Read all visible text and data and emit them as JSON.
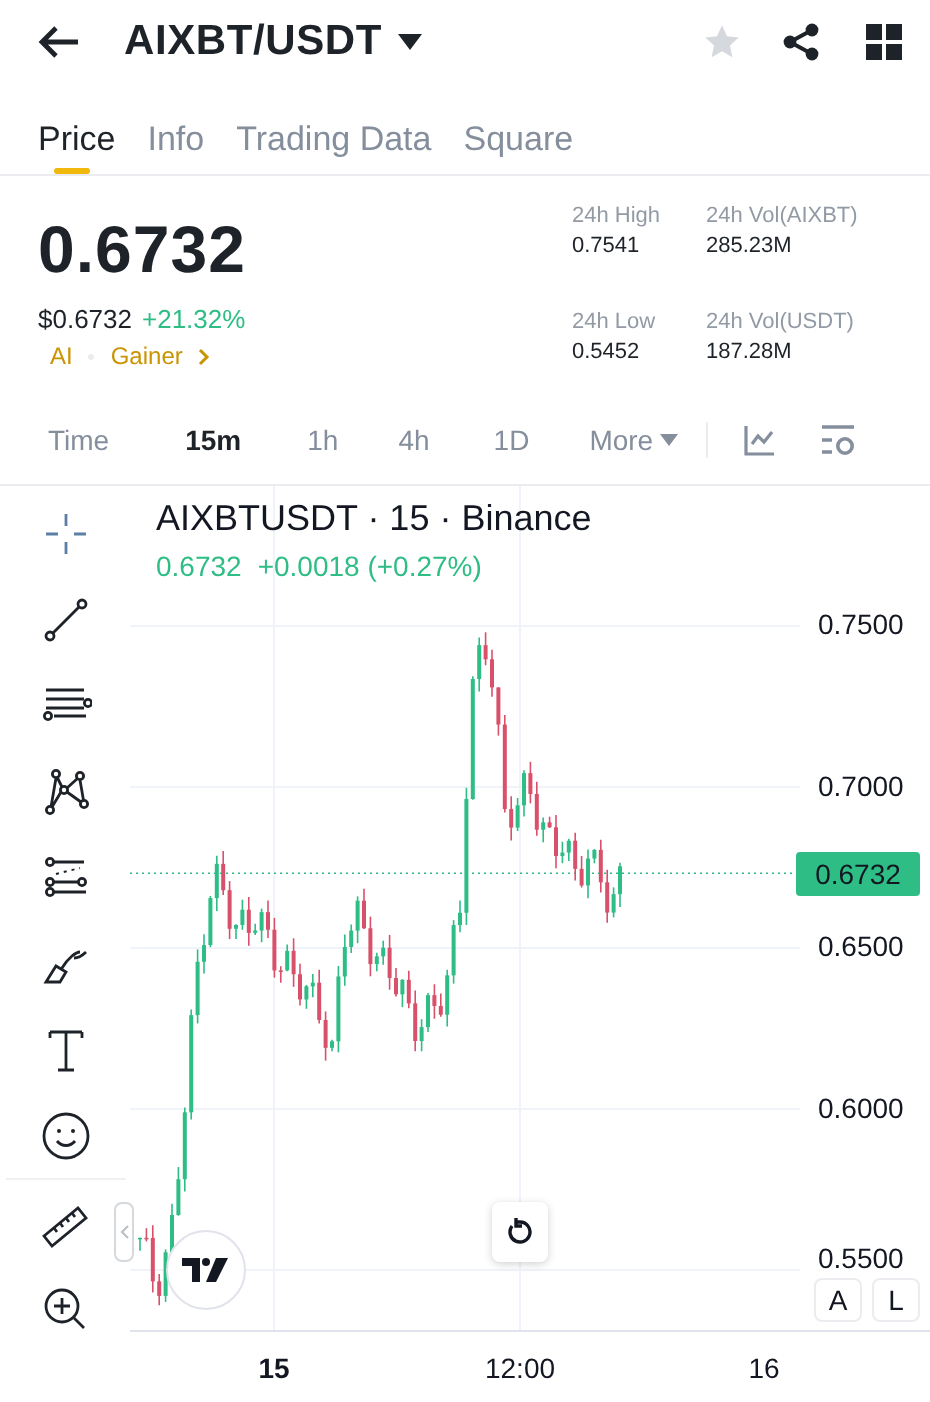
{
  "header": {
    "title": "AIXBT/USDT",
    "favorite": false
  },
  "tabs": [
    {
      "label": "Price",
      "selected": true
    },
    {
      "label": "Info",
      "selected": false
    },
    {
      "label": "Trading Data",
      "selected": false
    },
    {
      "label": "Square",
      "selected": false
    }
  ],
  "price": {
    "last": "0.6732",
    "fiat": "$0.6732",
    "change": "+21.32%",
    "tags": [
      "AI",
      "Gainer"
    ]
  },
  "stats": [
    {
      "label": "24h High",
      "value": "0.7541"
    },
    {
      "label": "24h Vol(AIXBT)",
      "value": "285.23M"
    },
    {
      "label": "24h Low",
      "value": "0.5452"
    },
    {
      "label": "24h Vol(USDT)",
      "value": "187.28M"
    }
  ],
  "intervals": [
    {
      "label": "Time",
      "selected": false,
      "kind": "option"
    },
    {
      "label": "15m",
      "selected": true,
      "kind": "option"
    },
    {
      "label": "1h",
      "selected": false,
      "kind": "option"
    },
    {
      "label": "4h",
      "selected": false,
      "kind": "option"
    },
    {
      "label": "1D",
      "selected": false,
      "kind": "option"
    },
    {
      "label": "More",
      "selected": false,
      "kind": "menu"
    }
  ],
  "chart": {
    "symbol": "AIXBTUSDT · 15 · Binance",
    "quote": "0.6732",
    "change": "+0.0018 (+0.27%)",
    "price_ticks": [
      "0.7500",
      "0.7000",
      "0.6500",
      "0.6000",
      "0.5500"
    ],
    "last_price": "0.6732",
    "time_ticks": [
      "15",
      "12:00",
      "16"
    ],
    "scale_buttons": [
      "A",
      "L"
    ]
  }
}
